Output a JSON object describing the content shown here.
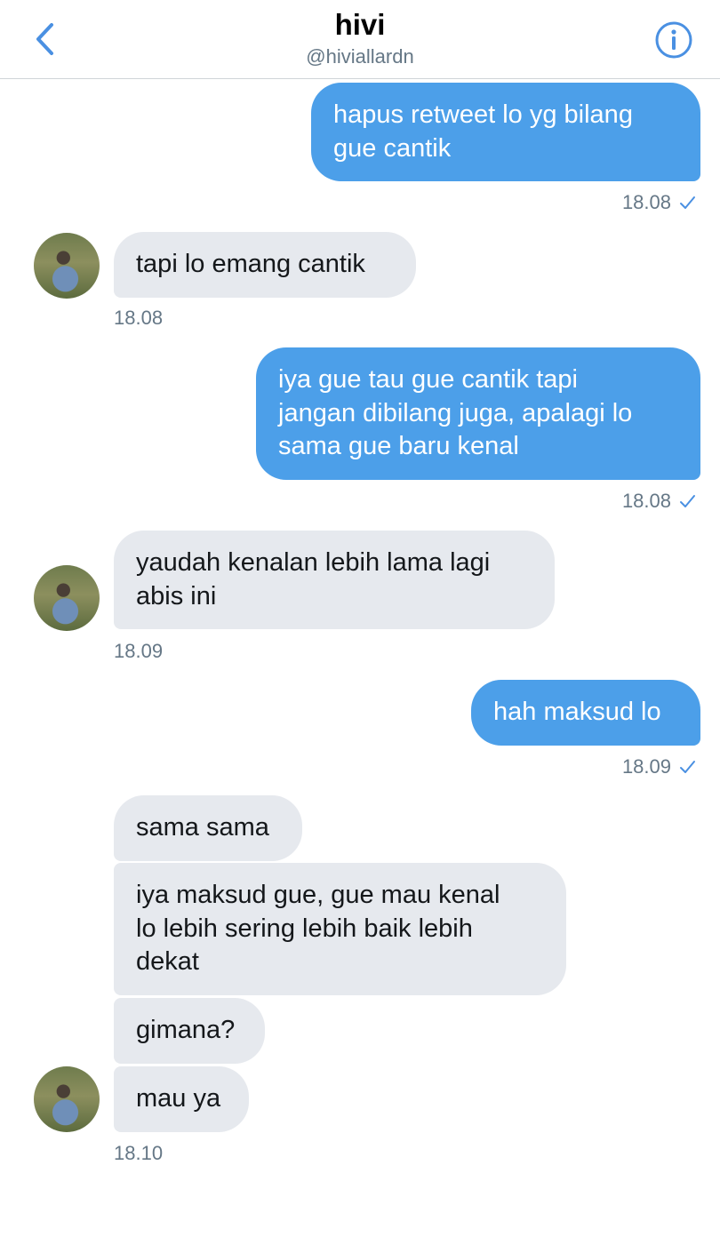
{
  "header": {
    "title": "hivi",
    "handle": "@hiviallardn"
  },
  "messages": [
    {
      "text_lines": [
        "hapus retweet lo yg bilang",
        "gue cantik"
      ],
      "time": "18.08"
    },
    {
      "text_lines": [
        "tapi lo emang cantik"
      ],
      "time": "18.08"
    },
    {
      "text_lines": [
        "iya gue tau gue cantik tapi",
        "jangan dibilang juga, apalagi lo",
        "sama gue baru kenal"
      ],
      "time": "18.08"
    },
    {
      "text_lines": [
        "yaudah kenalan lebih lama lagi",
        "abis ini"
      ],
      "time": "18.09"
    },
    {
      "text_lines": [
        "hah maksud lo"
      ],
      "time": "18.09"
    },
    {
      "text_lines": [
        "sama sama"
      ]
    },
    {
      "text_lines": [
        "iya maksud gue, gue mau kenal",
        "lo lebih sering lebih baik lebih",
        "dekat"
      ]
    },
    {
      "text_lines": [
        "gimana?"
      ]
    },
    {
      "text_lines": [
        "mau ya"
      ],
      "time": "18.10"
    }
  ],
  "colors": {
    "outgoing_bubble": "#4c9fe9",
    "incoming_bubble": "#e6e9ee",
    "accent": "#4a90e2"
  },
  "icons": {
    "back": "chevron-left-icon",
    "info": "info-icon",
    "read_receipt": "check-icon"
  }
}
